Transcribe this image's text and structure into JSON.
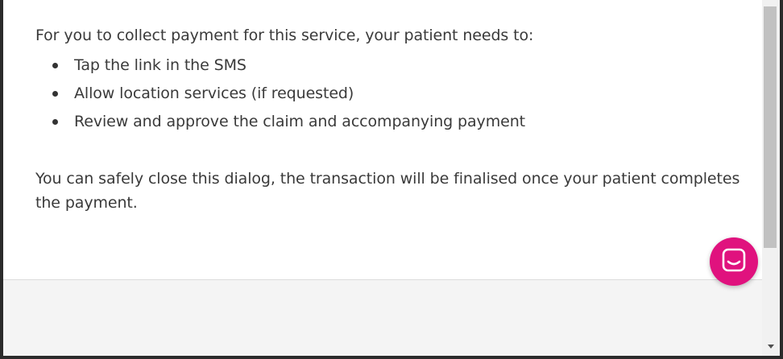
{
  "dialog": {
    "intro": "For you to collect payment for this service, your patient needs to:",
    "steps": [
      {
        "label": "Tap the link in the SMS"
      },
      {
        "label": "Allow location services (if requested)"
      },
      {
        "label": "Review and approve the claim and accompanying payment"
      }
    ],
    "closing": "You can safely close this dialog, the transaction will be finalised once your patient completes the payment."
  },
  "chat_widget": {
    "icon": "chat-icon",
    "color": "#e0127e"
  },
  "colors": {
    "text": "#3a3a3a",
    "footer": "#f4f4f4",
    "accent": "#e0127e"
  }
}
